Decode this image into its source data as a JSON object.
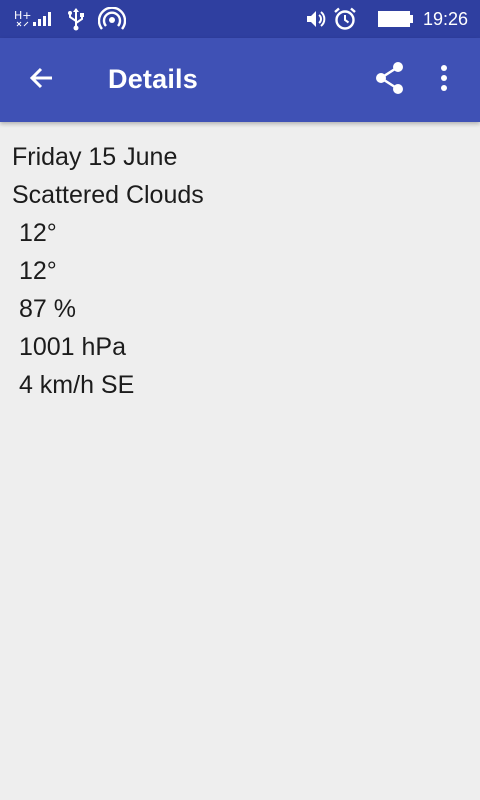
{
  "status_bar": {
    "time": "19:26",
    "icons": [
      "network-h-plus-icon",
      "signal-icon",
      "usb-icon",
      "hotspot-icon",
      "volume-icon",
      "alarm-icon",
      "battery-icon"
    ]
  },
  "app_bar": {
    "title": "Details",
    "back_icon": "arrow-back-icon",
    "share_icon": "share-icon",
    "more_icon": "more-vert-icon",
    "color": "#3f51b5",
    "status_color": "#2f3fa0"
  },
  "details": {
    "date": "Friday 15 June",
    "description": "Scattered Clouds",
    "temperature_max": " 12°",
    "temperature_min": " 12°",
    "humidity": " 87 %",
    "pressure": " 1001 hPa",
    "wind": " 4 km/h SE"
  }
}
